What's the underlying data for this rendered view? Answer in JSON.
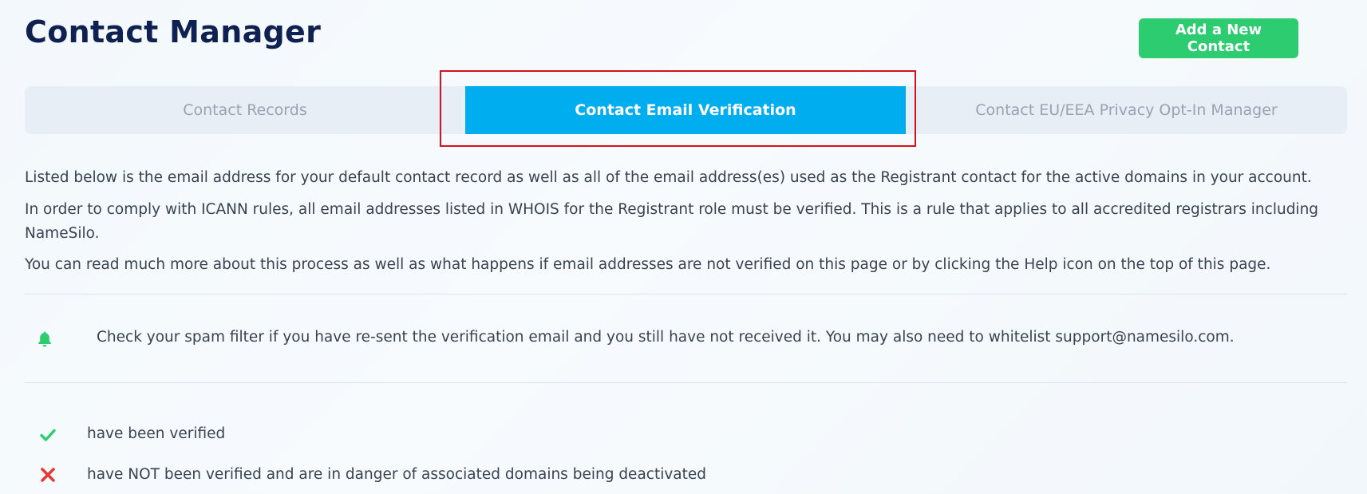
{
  "header": {
    "title": "Contact Manager",
    "add_button_label": "Add a New Contact"
  },
  "tabs": [
    {
      "label": "Contact Records",
      "active": false
    },
    {
      "label": "Contact Email Verification",
      "active": true
    },
    {
      "label": "Contact EU/EEA Privacy Opt-In Manager",
      "active": false
    }
  ],
  "intro": {
    "p1": "Listed below is the email address for your default contact record as well as all of the email address(es) used as the Registrant contact for the active domains in your account.",
    "p2": "In order to comply with ICANN rules, all email addresses listed in WHOIS for the Registrant role must be verified. This is a rule that applies to all accredited registrars including NameSilo.",
    "p3": "You can read much more about this process as well as what happens if email addresses are not verified on this page or by clicking the Help icon on the top of this page."
  },
  "notice": {
    "icon": "bell-icon",
    "text": "Check your spam filter if you have re-sent the verification email and you still have not received it. You may also need to whitelist support@namesilo.com."
  },
  "legend": [
    {
      "icon": "check-icon",
      "color": "#2ecc71",
      "text": "have been verified"
    },
    {
      "icon": "cross-icon",
      "color": "#e53935",
      "text": "have NOT been verified and are in danger of associated domains being deactivated"
    }
  ],
  "colors": {
    "brand_green": "#2ecc71",
    "tab_active": "#00aef0",
    "title": "#0f2150",
    "highlight": "#d6121e"
  }
}
